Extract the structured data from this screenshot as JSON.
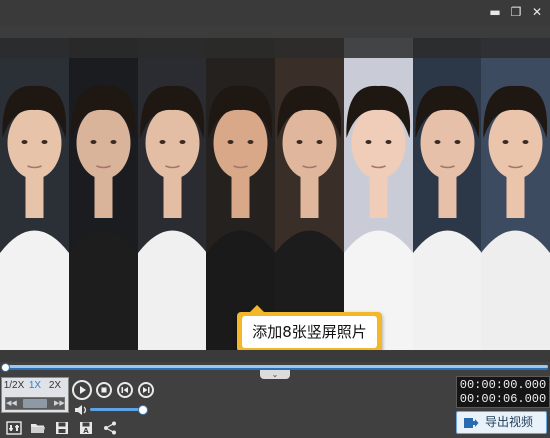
{
  "window": {
    "minimize_glyph": "▬",
    "restore_glyph": "❐",
    "close_glyph": "✕"
  },
  "preview": {
    "tooltip_text": "添加8张竖屏照片",
    "photo_count": 8
  },
  "timeline": {
    "collapse_glyph": "⌄",
    "progress": 0.0
  },
  "speed": {
    "options": [
      "1/2X",
      "1X",
      "2X"
    ],
    "selected": "1X",
    "left_glyph": "◀◀",
    "right_glyph": "▶▶"
  },
  "playback": {
    "buttons": [
      "play",
      "stop",
      "previous-frame",
      "next-frame"
    ]
  },
  "volume": {
    "level": 0.92
  },
  "time": {
    "current": "00:00:00.000",
    "total": "00:00:06.000"
  },
  "toolbar": {
    "export_label": "导出视频",
    "tools": [
      "settings-icon",
      "open-folder-icon",
      "save-icon",
      "save-as-icon",
      "share-icon"
    ]
  },
  "colors": {
    "accent": "#2a7fd6",
    "tooltip_border": "#f3b72a",
    "timeline": "#2e6fb3"
  }
}
